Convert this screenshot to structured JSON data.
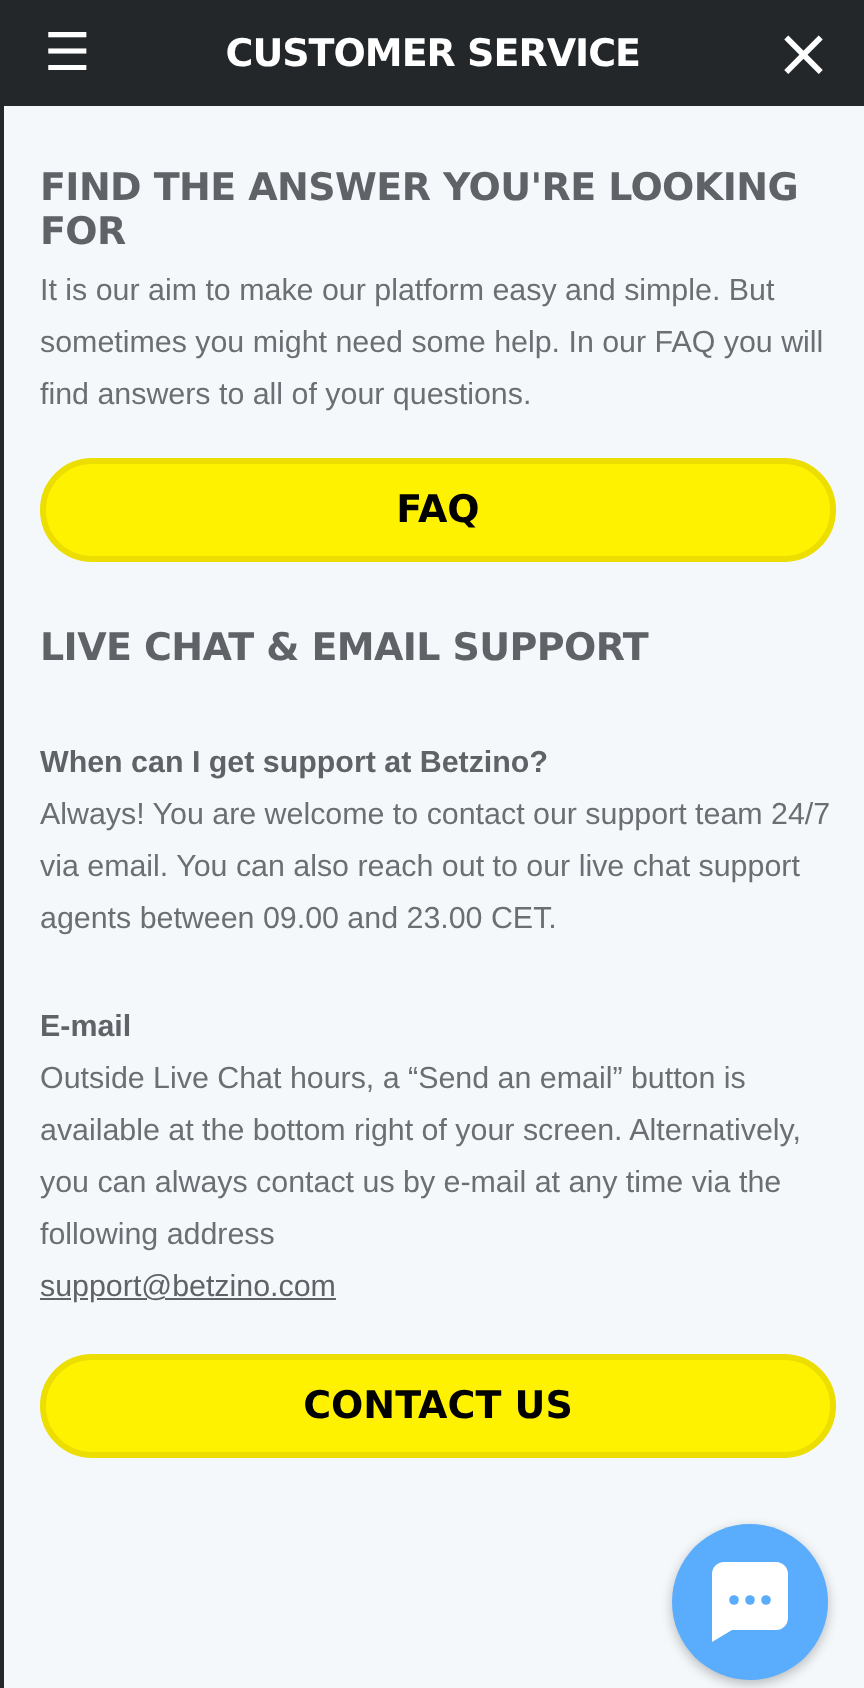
{
  "header": {
    "menu_icon": "☰",
    "title": "CUSTOMER SERVICE",
    "close_icon": "×"
  },
  "sections": [
    {
      "kind": "faq",
      "heading": "FIND THE ANSWER YOU'RE LOOKING FOR",
      "intro": "It is our aim to make our platform easy and simple. But sometimes you might need some help. In our FAQ you will find answers to all of your questions.",
      "button": "FAQ"
    },
    {
      "kind": "support",
      "heading": "LIVE CHAT & EMAIL SUPPORT",
      "blocks": [
        {
          "title": "When can I get support at Betzino?",
          "text": "Always! You are welcome to contact our support team 24/7 via email. You can also reach out to our live chat support agents between 09.00 and 23.00 CET."
        },
        {
          "title": "E-mail",
          "text": "Outside Live Chat hours, a “Send an email” button is available at the bottom right of your screen. Alternatively, you can always contact us by e-mail at any time via the following address",
          "link": "support@betzino.com"
        }
      ],
      "button": "CONTACT US"
    }
  ]
}
